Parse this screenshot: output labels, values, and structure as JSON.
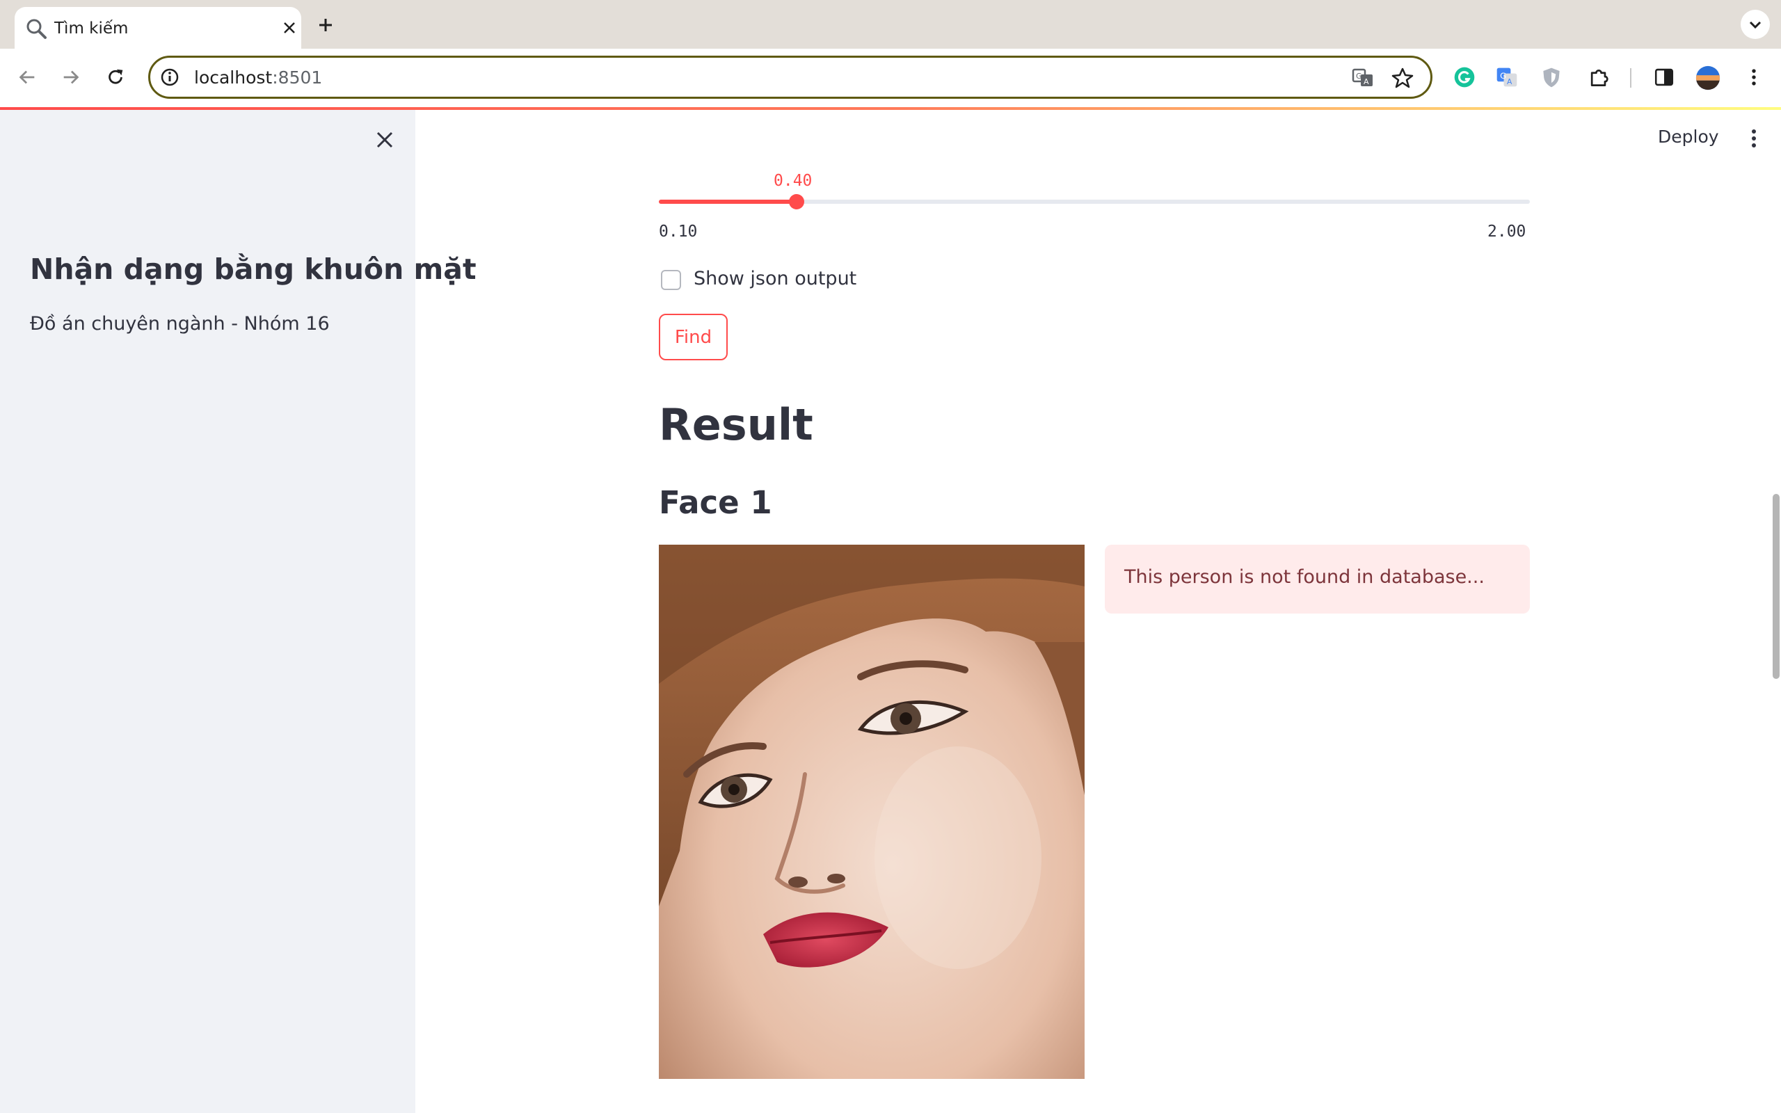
{
  "browser": {
    "tab_title": "Tìm kiếm",
    "url_host": "localhost",
    "url_port": ":8501",
    "icons": {
      "tab": "search-icon",
      "close": "close-icon",
      "new_tab": "plus-icon",
      "back": "back-arrow-icon",
      "forward": "forward-arrow-icon",
      "reload": "reload-icon",
      "site_info": "info-icon",
      "translate": "translate-icon",
      "bookmark": "star-icon",
      "extensions": [
        "grammarly-icon",
        "google-translate-icon",
        "shield-icon",
        "puzzle-icon"
      ],
      "side_panel": "side-panel-icon",
      "profile": "avatar",
      "menu": "kebab-menu-icon"
    }
  },
  "sidebar": {
    "title": "Nhận dạng bằng khuôn mặt",
    "subtitle": "Đồ án chuyên ngành - Nhóm 16"
  },
  "header": {
    "deploy_label": "Deploy"
  },
  "slider": {
    "value": "0.40",
    "min": "0.10",
    "max": "2.00",
    "value_fraction": 0.158
  },
  "checkbox": {
    "label": "Show json output",
    "checked": false
  },
  "find_button": {
    "label": "Find"
  },
  "result": {
    "title": "Result",
    "faces": [
      {
        "title": "Face 1",
        "message": "This person is not found in database..."
      }
    ]
  },
  "colors": {
    "accent": "#ff4b4b",
    "sidebar_bg": "#f0f2f6",
    "alert_bg": "#ffebeb",
    "alert_text": "#7d353b",
    "text": "#31333f"
  }
}
